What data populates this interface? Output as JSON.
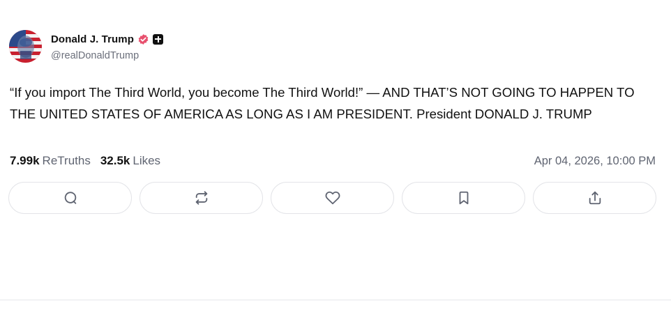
{
  "author": {
    "display_name": "Donald J. Trump",
    "handle": "@realDonaldTrump",
    "verified_icon": "verified-badge-icon",
    "plus_icon": "plus-badge-icon",
    "accent_color": "#e8506e"
  },
  "post": {
    "text": "“If you import The Third World, you become The Third World!” — AND THAT’S NOT GOING TO HAPPEN TO THE UNITED STATES OF AMERICA AS LONG AS I AM PRESIDENT. President DONALD J. TRUMP"
  },
  "stats": {
    "retruths_count": "7.99k",
    "retruths_label": "ReTruths",
    "likes_count": "32.5k",
    "likes_label": "Likes",
    "timestamp": "Apr 04, 2026, 10:00 PM"
  },
  "actions": [
    {
      "name": "reply",
      "icon": "reply-icon"
    },
    {
      "name": "retruth",
      "icon": "retruth-icon"
    },
    {
      "name": "like",
      "icon": "heart-icon"
    },
    {
      "name": "bookmark",
      "icon": "bookmark-icon"
    },
    {
      "name": "share",
      "icon": "share-icon"
    }
  ]
}
